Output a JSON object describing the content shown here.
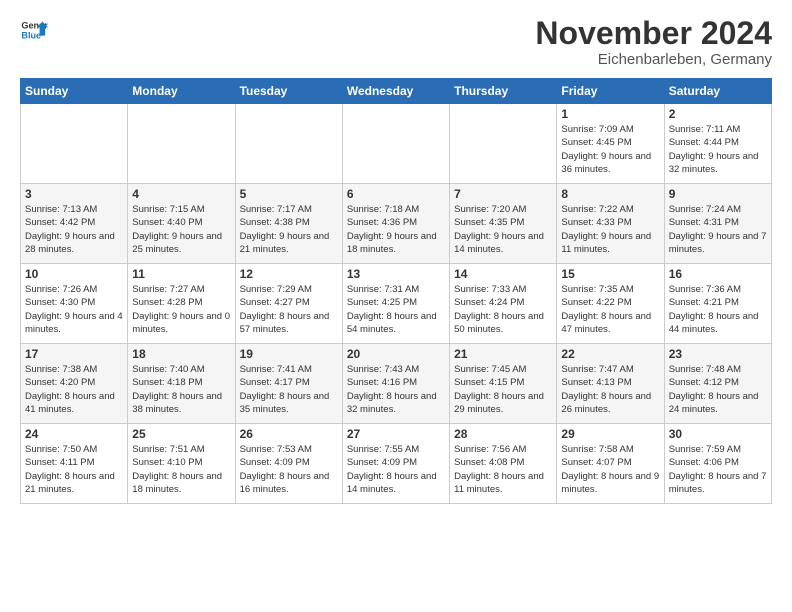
{
  "logo": {
    "line1": "General",
    "line2": "Blue"
  },
  "title": "November 2024",
  "location": "Eichenbarleben, Germany",
  "weekdays": [
    "Sunday",
    "Monday",
    "Tuesday",
    "Wednesday",
    "Thursday",
    "Friday",
    "Saturday"
  ],
  "weeks": [
    [
      {
        "day": "",
        "info": ""
      },
      {
        "day": "",
        "info": ""
      },
      {
        "day": "",
        "info": ""
      },
      {
        "day": "",
        "info": ""
      },
      {
        "day": "",
        "info": ""
      },
      {
        "day": "1",
        "info": "Sunrise: 7:09 AM\nSunset: 4:45 PM\nDaylight: 9 hours\nand 36 minutes."
      },
      {
        "day": "2",
        "info": "Sunrise: 7:11 AM\nSunset: 4:44 PM\nDaylight: 9 hours\nand 32 minutes."
      }
    ],
    [
      {
        "day": "3",
        "info": "Sunrise: 7:13 AM\nSunset: 4:42 PM\nDaylight: 9 hours\nand 28 minutes."
      },
      {
        "day": "4",
        "info": "Sunrise: 7:15 AM\nSunset: 4:40 PM\nDaylight: 9 hours\nand 25 minutes."
      },
      {
        "day": "5",
        "info": "Sunrise: 7:17 AM\nSunset: 4:38 PM\nDaylight: 9 hours\nand 21 minutes."
      },
      {
        "day": "6",
        "info": "Sunrise: 7:18 AM\nSunset: 4:36 PM\nDaylight: 9 hours\nand 18 minutes."
      },
      {
        "day": "7",
        "info": "Sunrise: 7:20 AM\nSunset: 4:35 PM\nDaylight: 9 hours\nand 14 minutes."
      },
      {
        "day": "8",
        "info": "Sunrise: 7:22 AM\nSunset: 4:33 PM\nDaylight: 9 hours\nand 11 minutes."
      },
      {
        "day": "9",
        "info": "Sunrise: 7:24 AM\nSunset: 4:31 PM\nDaylight: 9 hours\nand 7 minutes."
      }
    ],
    [
      {
        "day": "10",
        "info": "Sunrise: 7:26 AM\nSunset: 4:30 PM\nDaylight: 9 hours\nand 4 minutes."
      },
      {
        "day": "11",
        "info": "Sunrise: 7:27 AM\nSunset: 4:28 PM\nDaylight: 9 hours\nand 0 minutes."
      },
      {
        "day": "12",
        "info": "Sunrise: 7:29 AM\nSunset: 4:27 PM\nDaylight: 8 hours\nand 57 minutes."
      },
      {
        "day": "13",
        "info": "Sunrise: 7:31 AM\nSunset: 4:25 PM\nDaylight: 8 hours\nand 54 minutes."
      },
      {
        "day": "14",
        "info": "Sunrise: 7:33 AM\nSunset: 4:24 PM\nDaylight: 8 hours\nand 50 minutes."
      },
      {
        "day": "15",
        "info": "Sunrise: 7:35 AM\nSunset: 4:22 PM\nDaylight: 8 hours\nand 47 minutes."
      },
      {
        "day": "16",
        "info": "Sunrise: 7:36 AM\nSunset: 4:21 PM\nDaylight: 8 hours\nand 44 minutes."
      }
    ],
    [
      {
        "day": "17",
        "info": "Sunrise: 7:38 AM\nSunset: 4:20 PM\nDaylight: 8 hours\nand 41 minutes."
      },
      {
        "day": "18",
        "info": "Sunrise: 7:40 AM\nSunset: 4:18 PM\nDaylight: 8 hours\nand 38 minutes."
      },
      {
        "day": "19",
        "info": "Sunrise: 7:41 AM\nSunset: 4:17 PM\nDaylight: 8 hours\nand 35 minutes."
      },
      {
        "day": "20",
        "info": "Sunrise: 7:43 AM\nSunset: 4:16 PM\nDaylight: 8 hours\nand 32 minutes."
      },
      {
        "day": "21",
        "info": "Sunrise: 7:45 AM\nSunset: 4:15 PM\nDaylight: 8 hours\nand 29 minutes."
      },
      {
        "day": "22",
        "info": "Sunrise: 7:47 AM\nSunset: 4:13 PM\nDaylight: 8 hours\nand 26 minutes."
      },
      {
        "day": "23",
        "info": "Sunrise: 7:48 AM\nSunset: 4:12 PM\nDaylight: 8 hours\nand 24 minutes."
      }
    ],
    [
      {
        "day": "24",
        "info": "Sunrise: 7:50 AM\nSunset: 4:11 PM\nDaylight: 8 hours\nand 21 minutes."
      },
      {
        "day": "25",
        "info": "Sunrise: 7:51 AM\nSunset: 4:10 PM\nDaylight: 8 hours\nand 18 minutes."
      },
      {
        "day": "26",
        "info": "Sunrise: 7:53 AM\nSunset: 4:09 PM\nDaylight: 8 hours\nand 16 minutes."
      },
      {
        "day": "27",
        "info": "Sunrise: 7:55 AM\nSunset: 4:09 PM\nDaylight: 8 hours\nand 14 minutes."
      },
      {
        "day": "28",
        "info": "Sunrise: 7:56 AM\nSunset: 4:08 PM\nDaylight: 8 hours\nand 11 minutes."
      },
      {
        "day": "29",
        "info": "Sunrise: 7:58 AM\nSunset: 4:07 PM\nDaylight: 8 hours\nand 9 minutes."
      },
      {
        "day": "30",
        "info": "Sunrise: 7:59 AM\nSunset: 4:06 PM\nDaylight: 8 hours\nand 7 minutes."
      }
    ]
  ]
}
